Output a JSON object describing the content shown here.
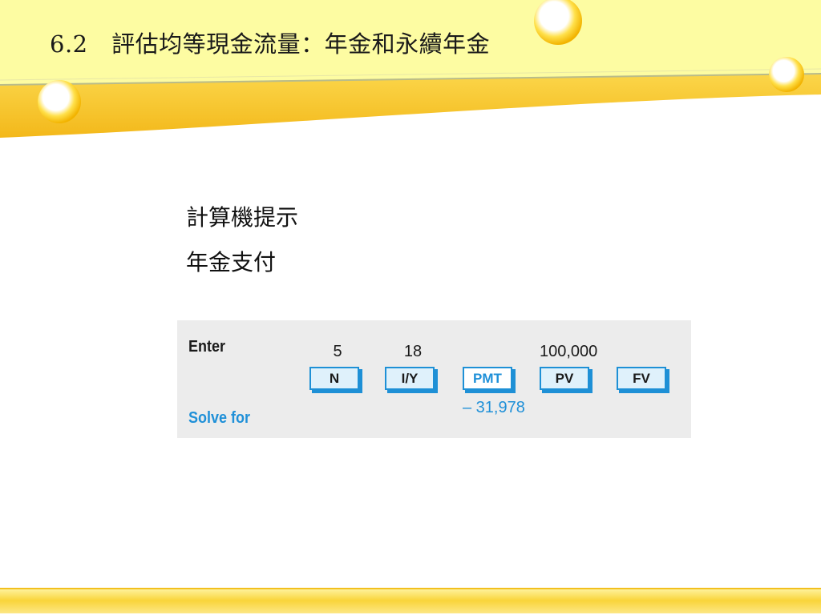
{
  "slide": {
    "title": "6.2　評估均等現金流量：年金和永續年金",
    "subtitle_1": "計算機提示",
    "subtitle_2": "年金支付"
  },
  "calculator": {
    "enter_label": "Enter",
    "solve_label": "Solve for",
    "keys": [
      {
        "label": "N",
        "input": "5",
        "output": ""
      },
      {
        "label": "I/Y",
        "input": "18",
        "output": ""
      },
      {
        "label": "PMT",
        "input": "",
        "output": "– 31,978"
      },
      {
        "label": "PV",
        "input": "100,000",
        "output": ""
      },
      {
        "label": "FV",
        "input": "",
        "output": ""
      }
    ]
  },
  "colors": {
    "accent_yellow": "#f7c21a",
    "header_yellow": "#fdfaa0",
    "calculator_blue": "#1f90d8",
    "panel_gray": "#ececec"
  }
}
